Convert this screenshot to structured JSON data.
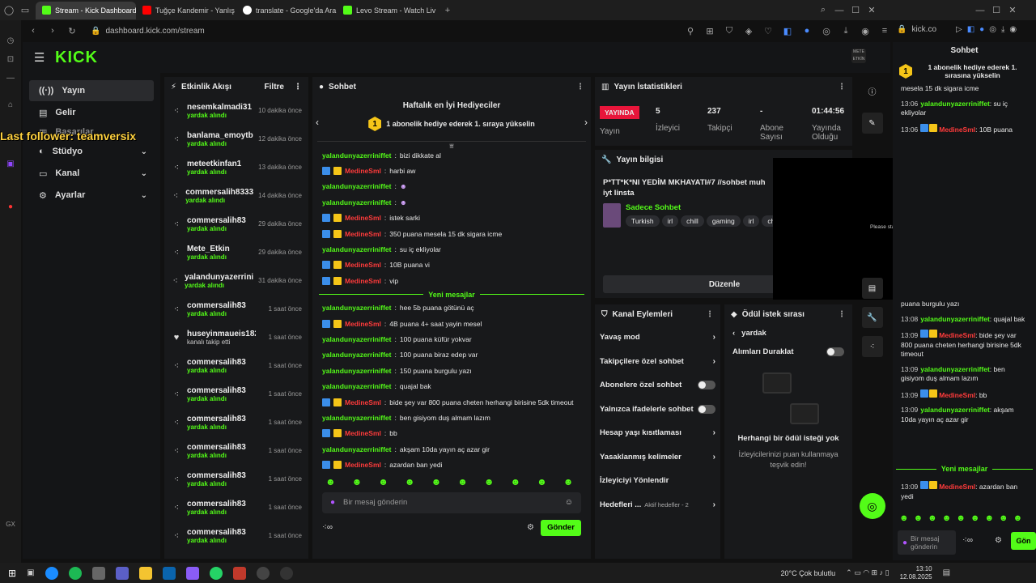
{
  "browser": {
    "tabs": [
      {
        "label": "Stream - Kick Dashboard",
        "color": "#53fc18",
        "active": true
      },
      {
        "label": "Tuğçe Kandemir - Yanlış",
        "color": "#ff0000",
        "active": false
      },
      {
        "label": "translate - Google'da Ara",
        "color": "#ffffff",
        "active": false
      },
      {
        "label": "Levo Stream - Watch Liv",
        "color": "#53fc18",
        "active": false
      }
    ],
    "url": "dashboard.kick.com/stream",
    "right_url": "kick.co"
  },
  "logo": "KICK",
  "overlay_follower": "Last follower: teamversix",
  "sidebar": {
    "items": [
      {
        "label": "Yayın",
        "icon": "broadcast-icon",
        "active": true,
        "chev": false
      },
      {
        "label": "Gelir",
        "icon": "money-icon",
        "active": false,
        "chev": false
      },
      {
        "label": "Stüdyo",
        "icon": "studio-icon",
        "active": false,
        "chev": true
      },
      {
        "label": "Kanal",
        "icon": "channel-icon",
        "active": false,
        "chev": true
      },
      {
        "label": "Ayarlar",
        "icon": "gear-icon",
        "active": false,
        "chev": true
      }
    ],
    "hidden_label": "Başarılar"
  },
  "activity": {
    "title": "Etkinlik Akışı",
    "filter": "Filtre",
    "items": [
      {
        "name": "nesemkalmadi31",
        "status": "yardak alındı",
        "time": "10 dakika önce"
      },
      {
        "name": "banlama_emoytb",
        "status": "yardak alındı",
        "time": "12 dakika önce"
      },
      {
        "name": "meteetkinfan1",
        "status": "yardak alındı",
        "time": "13 dakika önce"
      },
      {
        "name": "commersalih8333",
        "status": "yardak alındı",
        "time": "14 dakika önce"
      },
      {
        "name": "commersalih83",
        "status": "yardak alındı",
        "time": "29 dakika önce"
      },
      {
        "name": "Mete_Etkin",
        "status": "yardak alındı",
        "time": "29 dakika önce"
      },
      {
        "name": "yalandunyazerriniffet",
        "status": "yardak alındı",
        "time": "31 dakika önce"
      },
      {
        "name": "commersalih83",
        "status": "yardak alındı",
        "time": "1 saat önce"
      },
      {
        "name": "huseyinmaueis182",
        "status": "kanalı takip etti",
        "time": "1 saat önce"
      },
      {
        "name": "commersalih83",
        "status": "yardak alındı",
        "time": "1 saat önce"
      },
      {
        "name": "commersalih83",
        "status": "yardak alındı",
        "time": "1 saat önce"
      },
      {
        "name": "commersalih83",
        "status": "yardak alındı",
        "time": "1 saat önce"
      },
      {
        "name": "commersalih83",
        "status": "yardak alındı",
        "time": "1 saat önce"
      },
      {
        "name": "commersalih83",
        "status": "yardak alındı",
        "time": "1 saat önce"
      },
      {
        "name": "commersalih83",
        "status": "yardak alındı",
        "time": "1 saat önce"
      },
      {
        "name": "commersalih83",
        "status": "yardak alındı",
        "time": "1 saat önce"
      }
    ]
  },
  "chat": {
    "title": "Sohbet",
    "gifters_title": "Haftalık en İyi Hediyeciler",
    "gifter_rank": "1",
    "gifter_text": "1 abonelik hediye ederek 1. sıraya yükselin",
    "new_messages": "Yeni mesajlar",
    "placeholder": "Bir mesaj gönderin",
    "send": "Gönder",
    "messages": [
      {
        "user": "yalandunyazerriniffet",
        "text": "bizi dikkate al",
        "mod": false
      },
      {
        "user": "MedineSml",
        "text": "harbi aw",
        "mod": true
      },
      {
        "user": "yalandunyazerriniffet",
        "text": "",
        "mod": false
      },
      {
        "user": "yalandunyazerriniffet",
        "text": "",
        "mod": false
      },
      {
        "user": "MedineSml",
        "text": "istek sarki",
        "mod": true
      },
      {
        "user": "MedineSml",
        "text": "350 puana mesela 15 dk sigara icme",
        "mod": true
      },
      {
        "user": "yalandunyazerriniffet",
        "text": "su iç ekliyolar",
        "mod": false
      },
      {
        "user": "MedineSml",
        "text": "10B puana vi",
        "mod": true
      },
      {
        "user": "MedineSml",
        "text": "vip",
        "mod": true
      }
    ],
    "messages2": [
      {
        "user": "yalandunyazerriniffet",
        "text": "hee 5b puana götünü aç",
        "mod": false
      },
      {
        "user": "MedineSml",
        "text": "4B puana 4+ saat yayin mesel",
        "mod": true
      },
      {
        "user": "yalandunyazerriniffet",
        "text": "100 puana küfür yokvar",
        "mod": false
      },
      {
        "user": "yalandunyazerriniffet",
        "text": "100 puana biraz edep var",
        "mod": false
      },
      {
        "user": "yalandunyazerriniffet",
        "text": "150 puana burgulu yazı",
        "mod": false
      },
      {
        "user": "yalandunyazerriniffet",
        "text": "quajal bak",
        "mod": false
      },
      {
        "user": "MedineSml",
        "text": "bide şey var 800 puana cheten herhangi birisine 5dk timeout",
        "mod": true
      },
      {
        "user": "yalandunyazerriniffet",
        "text": "ben gisiyom duş almam lazım",
        "mod": false
      },
      {
        "user": "MedineSml",
        "text": "bb",
        "mod": true
      },
      {
        "user": "yalandunyazerriniffet",
        "text": "akşam 10da yayın aç azar gir",
        "mod": false
      },
      {
        "user": "MedineSml",
        "text": "azardan ban yedi",
        "mod": true
      }
    ]
  },
  "stats": {
    "title": "Yayın İstatistikleri",
    "live_badge": "YAYINDA",
    "live_label": "Yayın",
    "viewers": "5",
    "viewers_label": "İzleyici",
    "followers": "237",
    "followers_label": "Takipçi",
    "subs": "-",
    "subs_label": "Abone Sayısı",
    "uptime": "01:44:56",
    "uptime_label": "Yayında Olduğu"
  },
  "info": {
    "title": "Yayın bilgisi",
    "stream_title": "P*TT*K*NI YEDİM MKHAYATI#7 //sohbet muh iyt Iinsta",
    "category": "Sadece Sohbet",
    "tags": [
      "Turkish",
      "irl",
      "chill",
      "gaming",
      "irl",
      "ch"
    ],
    "edit": "Düzenle"
  },
  "actions": {
    "title": "Kanal Eylemleri",
    "items": [
      {
        "label": "Yavaş mod",
        "kind": "arrow"
      },
      {
        "label": "Takipçilere özel sohbet",
        "kind": "arrow"
      },
      {
        "label": "Abonelere özel sohbet",
        "kind": "toggle"
      },
      {
        "label": "Yalnızca ifadelerle sohbet",
        "kind": "toggle"
      },
      {
        "label": "Hesap yaşı kısıtlaması",
        "kind": "arrow"
      },
      {
        "label": "Yasaklanmış kelimeler",
        "kind": "arrow"
      },
      {
        "label": "İzleyiciyi Yönlendir",
        "kind": "none"
      },
      {
        "label": "Hedefleri ...",
        "kind": "arrow",
        "extra": "Aktif hedefler - 2"
      }
    ]
  },
  "rewards": {
    "title": "Ödül istek sırası",
    "back": "yardak",
    "pause": "Alımları Duraklat",
    "empty_title": "Herhangi bir ödül isteği yok",
    "empty_sub": "İzleyicilerinizi puan kullanmaya teşvik edin!"
  },
  "overlay_text": "Please start Iriun Webcam",
  "right_chat": {
    "title": "Sohbet",
    "gift": "1 abonelik hediye ederek 1. sırasına yükselin",
    "lines_top": [
      {
        "time": "",
        "user": "",
        "text": "mesela 15 dk sigara icme"
      },
      {
        "time": "13:06",
        "user": "yalandunyazerriniffet",
        "text": "su iç ekliyolar"
      },
      {
        "time": "13:06",
        "user": "MedineSml",
        "text": "10B puana"
      }
    ],
    "lines_bottom": [
      {
        "time": "",
        "user": "",
        "text": "puana burgulu yazı"
      },
      {
        "time": "13:08",
        "user": "yalandunyazerriniffet",
        "text": "quajal bak"
      },
      {
        "time": "13:09",
        "user": "MedineSml",
        "text": "bide şey var 800 puana cheten herhangi birisine 5dk timeout"
      },
      {
        "time": "13:09",
        "user": "yalandunyazerriniffet",
        "text": "ben gisiyom duş almam lazım"
      },
      {
        "time": "13:09",
        "user": "MedineSml",
        "text": "bb"
      },
      {
        "time": "13:09",
        "user": "yalandunyazerriniffet",
        "text": "akşam 10da yayın aç azar gir"
      }
    ],
    "new_messages": "Yeni mesajlar",
    "last": {
      "time": "13:09",
      "user": "MedineSml",
      "text": "azardan ban yedi"
    },
    "placeholder": "Bir mesaj gönderin",
    "send": "Gön"
  },
  "taskbar": {
    "weather": "20°C Çok bulutlu",
    "time": "13:10",
    "date": "12.08.2025"
  },
  "colors": {
    "accent": "#53fc18",
    "mod_red": "#ff3b3b",
    "live_red": "#e8153a",
    "gold": "#f5c518"
  }
}
